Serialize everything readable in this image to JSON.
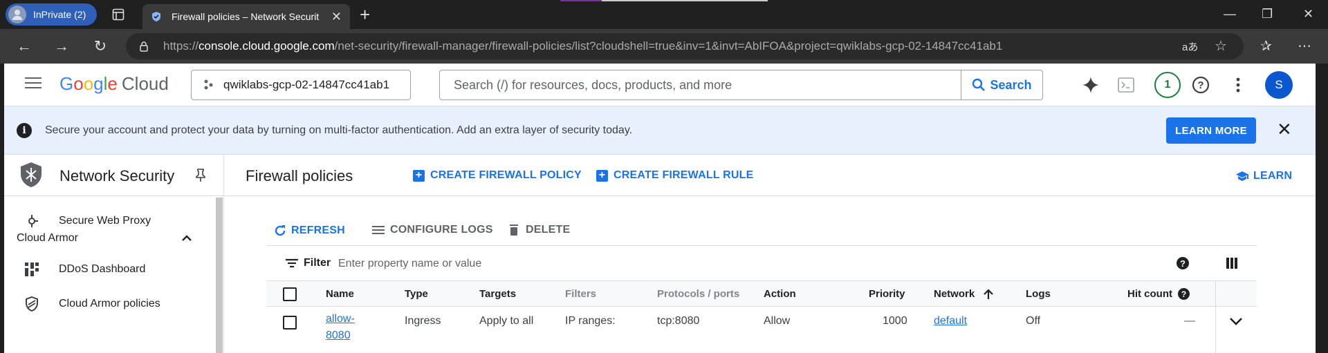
{
  "browser": {
    "profile_label": "InPrivate (2)",
    "tab_title": "Firewall policies – Network Securit",
    "url_prefix": "https://",
    "url_domain": "console.cloud.google.com",
    "url_rest": "/net-security/firewall-manager/firewall-policies/list?cloudshell=true&inv=1&invt=AbIFOA&project=qwiklabs-gcp-02-14847cc41ab1",
    "read_aloud_label": "aあ"
  },
  "topbar": {
    "logo_google": "Google",
    "logo_cloud": "Cloud",
    "project": "qwiklabs-gcp-02-14847cc41ab1",
    "search_placeholder": "Search (/) for resources, docs, products, and more",
    "search_button": "Search",
    "notification_count": "1",
    "avatar_letter": "S"
  },
  "banner": {
    "message": "Secure your account and protect your data by turning on multi-factor authentication. Add an extra layer of security today.",
    "learn_more": "LEARN MORE",
    "info_glyph": "i"
  },
  "sidebar": {
    "product_title": "Network Security",
    "items": [
      {
        "label": "Secure Web Proxy",
        "icon": "proxy-icon"
      },
      {
        "label": "DDoS Dashboard",
        "icon": "dashboard-icon"
      },
      {
        "label": "Cloud Armor policies",
        "icon": "armor-shield-icon"
      }
    ],
    "section_cloud_armor": "Cloud Armor"
  },
  "main": {
    "title": "Firewall policies",
    "create_policy": "CREATE FIREWALL POLICY",
    "create_rule": "CREATE FIREWALL RULE",
    "learn": "LEARN",
    "refresh": "REFRESH",
    "configure_logs": "CONFIGURE LOGS",
    "delete": "DELETE",
    "filter_label": "Filter",
    "filter_placeholder": "Enter property name or value"
  },
  "table": {
    "headers": {
      "name": "Name",
      "type": "Type",
      "targets": "Targets",
      "filters": "Filters",
      "protocols": "Protocols / ports",
      "action": "Action",
      "priority": "Priority",
      "network": "Network",
      "logs": "Logs",
      "hit_count": "Hit count"
    },
    "rows": [
      {
        "name_line1": "allow-",
        "name_line2": "8080",
        "type": "Ingress",
        "targets": "Apply to all",
        "filters": "IP ranges:",
        "protocols": "tcp:8080",
        "action": "Allow",
        "priority": "1000",
        "network": "default",
        "logs": "Off",
        "hit_count": "—"
      }
    ]
  },
  "colors": {
    "accent": "#1a73e8",
    "banner_bg": "#e8f0fe",
    "notification_green": "#188038",
    "avatar_blue": "#0b57d0"
  }
}
